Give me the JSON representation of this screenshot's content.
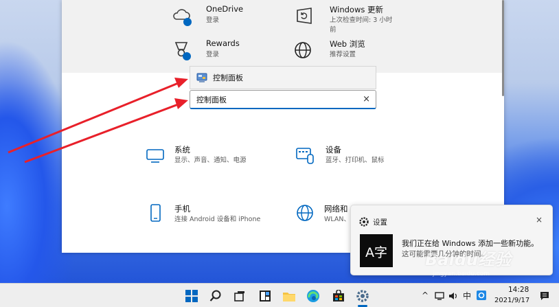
{
  "tiles": {
    "onedrive": {
      "title": "OneDrive",
      "subtitle": "登录"
    },
    "windows_update": {
      "title": "Windows 更新",
      "subtitle_line1": "上次检查时间: 3 小时",
      "subtitle_line2": "前"
    },
    "rewards": {
      "title": "Rewards",
      "subtitle": "登录"
    },
    "web_browse": {
      "title": "Web 浏览",
      "subtitle": "推荐设置"
    },
    "system": {
      "title": "系统",
      "subtitle": "显示、声音、通知、电源"
    },
    "devices": {
      "title": "设备",
      "subtitle": "蓝牙、打印机、鼠标"
    },
    "phone": {
      "title": "手机",
      "subtitle": "连接 Android 设备和 iPhone"
    },
    "network": {
      "title": "网络和",
      "subtitle": "WLAN、"
    }
  },
  "search": {
    "suggestion": "控制面板",
    "value": "控制面板",
    "clear": "×"
  },
  "notification": {
    "app": "设置",
    "close": "×",
    "logo_text": "A字",
    "line1": "我们正在给 Windows 添加一些新功能。",
    "line2": "这可能需要几分钟的时间。"
  },
  "watermark": {
    "text": "Baidu经验",
    "url": "jingyan.baidu.com"
  },
  "taskbar": {
    "time": "14:28",
    "date": "2021/9/17",
    "ime": "中",
    "tray_up": "^"
  },
  "colors": {
    "accent": "#0067c0",
    "arrow": "#e8202a",
    "notification_logo_bg": "#0c0c0c"
  }
}
